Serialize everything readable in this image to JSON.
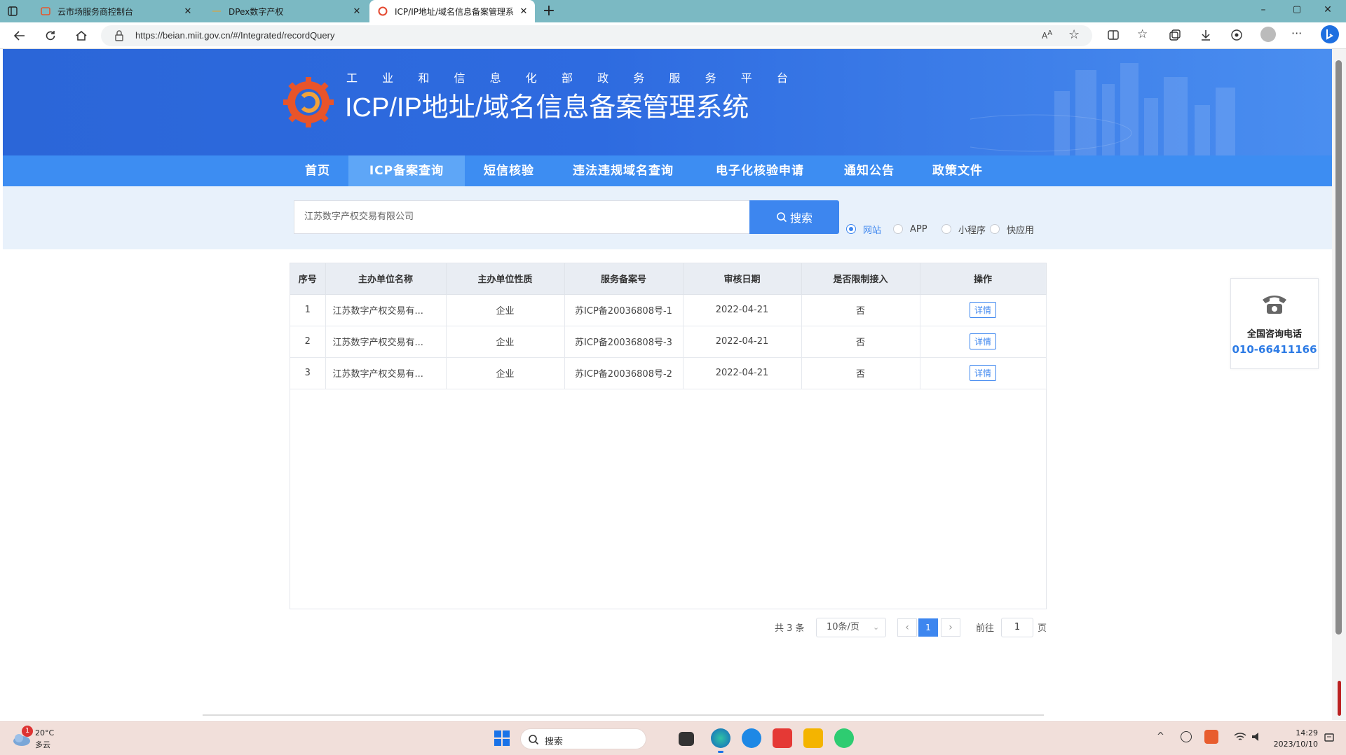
{
  "browser": {
    "tabs": [
      {
        "title": "云市场服务商控制台",
        "active": false
      },
      {
        "title": "DPex数字产权",
        "active": false
      },
      {
        "title": "ICP/IP地址/域名信息备案管理系",
        "active": true
      }
    ],
    "new_tab": "+",
    "url": "https://beian.miit.gov.cn/#/Integrated/recordQuery",
    "window_controls": {
      "minimize": "–",
      "maximize": "▢",
      "close": "✕"
    }
  },
  "header": {
    "subtitle_chars": [
      "工",
      "业",
      "和",
      "信",
      "息",
      "化",
      "部",
      "政",
      "务",
      "服",
      "务",
      "平",
      "台"
    ],
    "title": "ICP/IP地址/域名信息备案管理系统"
  },
  "nav": {
    "items": [
      {
        "label": "首页",
        "active": false
      },
      {
        "label": "ICP备案查询",
        "active": true
      },
      {
        "label": "短信核验",
        "active": false
      },
      {
        "label": "违法违规域名查询",
        "active": false
      },
      {
        "label": "电子化核验申请",
        "active": false
      },
      {
        "label": "通知公告",
        "active": false
      },
      {
        "label": "政策文件",
        "active": false
      }
    ]
  },
  "search": {
    "value": "江苏数字产权交易有限公司",
    "button_label": "搜索",
    "types": [
      {
        "label": "网站",
        "checked": true
      },
      {
        "label": "APP",
        "checked": false
      },
      {
        "label": "小程序",
        "checked": false
      },
      {
        "label": "快应用",
        "checked": false
      }
    ]
  },
  "table": {
    "columns": [
      "序号",
      "主办单位名称",
      "主办单位性质",
      "服务备案号",
      "审核日期",
      "是否限制接入",
      "操作"
    ],
    "rows": [
      {
        "index": "1",
        "name": "江苏数字产权交易有...",
        "nature": "企业",
        "record": "苏ICP备20036808号-1",
        "date": "2022-04-21",
        "restricted": "否",
        "action": "详情"
      },
      {
        "index": "2",
        "name": "江苏数字产权交易有...",
        "nature": "企业",
        "record": "苏ICP备20036808号-3",
        "date": "2022-04-21",
        "restricted": "否",
        "action": "详情"
      },
      {
        "index": "3",
        "name": "江苏数字产权交易有...",
        "nature": "企业",
        "record": "苏ICP备20036808号-2",
        "date": "2022-04-21",
        "restricted": "否",
        "action": "详情"
      }
    ]
  },
  "pagination": {
    "total": "共 3 条",
    "page_size": "10条/页",
    "current": "1",
    "goto_prefix": "前往",
    "goto_value": "1",
    "goto_suffix": "页"
  },
  "contact": {
    "label": "全国咨询电话",
    "phone": "010-66411166"
  },
  "taskbar": {
    "weather_temp": "20°C",
    "weather_desc": "多云",
    "weather_badge": "1",
    "search_placeholder": "搜索",
    "time": "14:29",
    "date": "2023/10/10"
  },
  "colors": {
    "brand_blue": "#3d86ef",
    "banner": "#2b66d8",
    "nav_bg": "#3d8df2",
    "tabbar": "#7bb9c3",
    "taskbar": "#f1dfda"
  }
}
